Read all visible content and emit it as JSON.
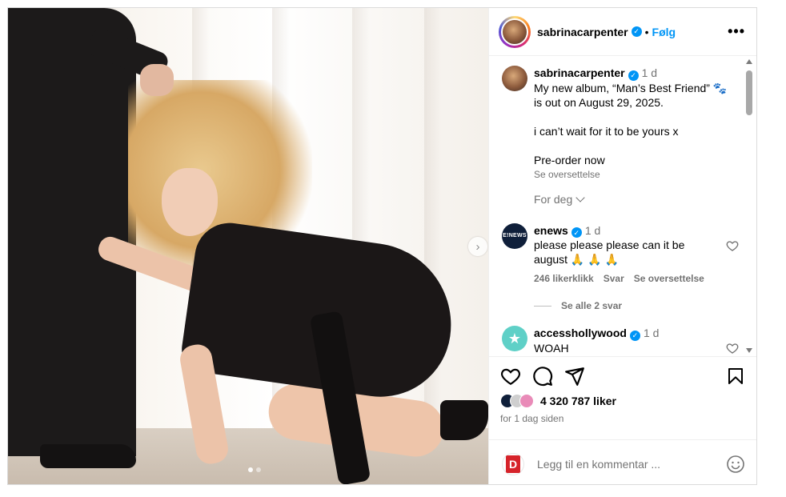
{
  "post": {
    "username": "sabrinacarpenter",
    "separator": "•",
    "follow_label": "Følg",
    "more_label": "•••",
    "caption": {
      "username": "sabrinacarpenter",
      "time": "1 d",
      "line1": "My new album, “Man’s Best Friend” 🐾",
      "line2": "is out on August 29, 2025.",
      "line3": "i can’t wait for it to be yours x",
      "line4": "Pre-order now",
      "translate": "Se oversettelse"
    },
    "for_you_label": "For deg",
    "comments": [
      {
        "username": "enews",
        "avatar_text": "E!NEWS",
        "time": "1 d",
        "text": "please please please can it be\naugust 🙏 🙏 🙏",
        "likes": "246 likerklikk",
        "reply": "Svar",
        "translate": "Se oversettelse",
        "view_replies": "Se alle 2 svar"
      },
      {
        "username": "accesshollywood",
        "avatar_text": "★",
        "time": "1 d",
        "text": "WOAH"
      }
    ],
    "likes_text": "4 320 787 liker",
    "timestamp": "for 1 dag siden",
    "comment_placeholder": "Legg til en kommentar ...",
    "viewer_avatar_letter": "D",
    "next_label": "›",
    "carousel": {
      "slides": 2,
      "active": 1
    },
    "icons": [
      "verified-icon",
      "heart-icon",
      "comment-icon",
      "share-icon",
      "bookmark-icon",
      "emoji-icon",
      "chevron-down-icon",
      "next-arrow-icon"
    ],
    "colors": {
      "link": "#0095f6",
      "muted": "#737373",
      "brand_d": "#d6232a"
    }
  }
}
